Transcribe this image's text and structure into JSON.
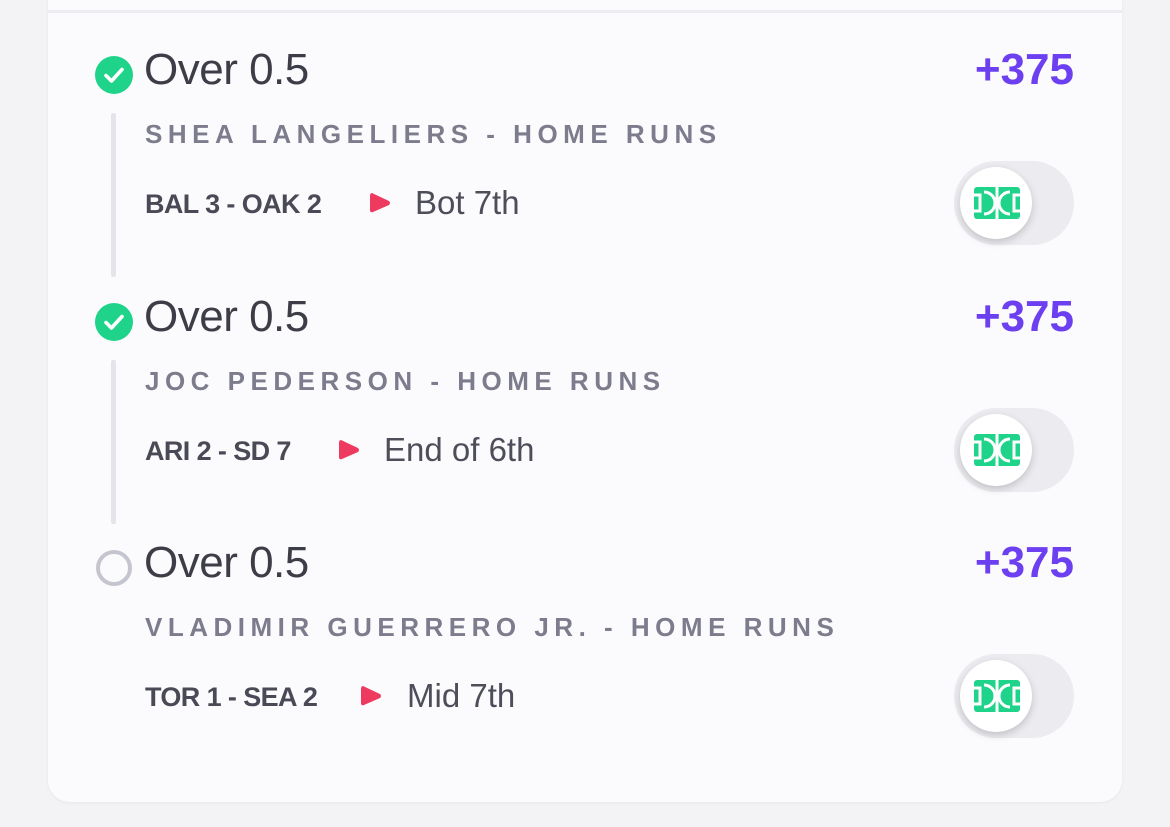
{
  "colors": {
    "accent_odds": "#6c3ff0",
    "won_status": "#1fd48a",
    "live_indicator": "#ee3a5e",
    "field_icon": "#1fd48a"
  },
  "legs": [
    {
      "status": "won",
      "status_icon": "check-circle-icon",
      "selection": "Over 0.5",
      "odds": "+375",
      "market": "SHEA LANGELIERS - HOME RUNS",
      "score": "BAL 3 - OAK 2",
      "inning": "Bot 7th",
      "live_icon": "play-triangle-icon",
      "toggle_icon": "field-icon"
    },
    {
      "status": "won",
      "status_icon": "check-circle-icon",
      "selection": "Over 0.5",
      "odds": "+375",
      "market": "JOC PEDERSON - HOME RUNS",
      "score": "ARI 2 - SD 7",
      "inning": "End of 6th",
      "live_icon": "play-triangle-icon",
      "toggle_icon": "field-icon"
    },
    {
      "status": "pending",
      "status_icon": "empty-circle-icon",
      "selection": "Over 0.5",
      "odds": "+375",
      "market": "VLADIMIR GUERRERO JR. - HOME RUNS",
      "score": "TOR 1 - SEA 2",
      "inning": "Mid 7th",
      "live_icon": "play-triangle-icon",
      "toggle_icon": "field-icon"
    }
  ]
}
